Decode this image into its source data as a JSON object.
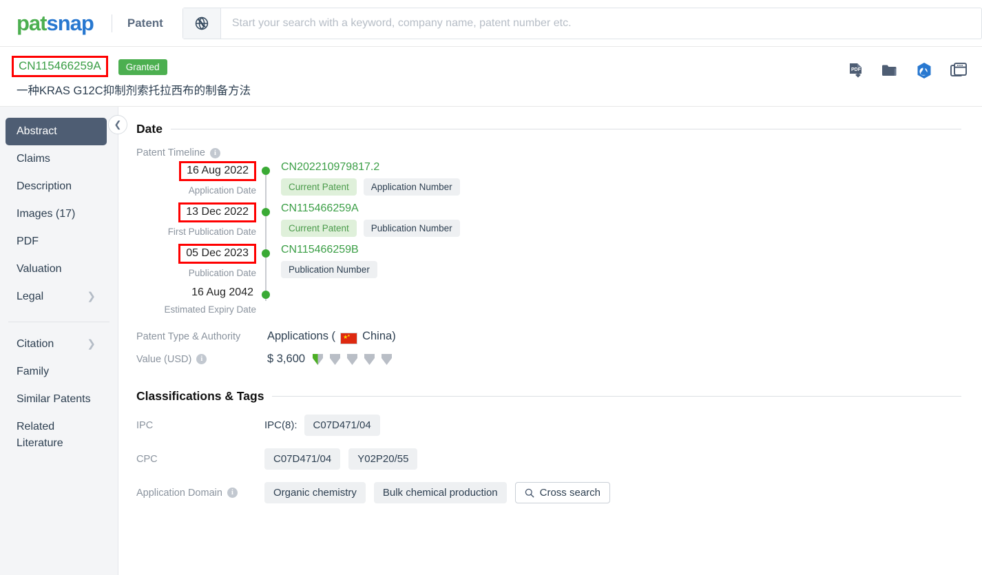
{
  "brand": {
    "logo_pat": "pat",
    "logo_snap": "snap",
    "nav_label": "Patent"
  },
  "search": {
    "placeholder": "Start your search with a keyword, company name, patent number etc.",
    "value": "",
    "globe_icon": "globe-icon"
  },
  "patent": {
    "number": "CN115466259A",
    "status": "Granted",
    "title": "一种KRAS G12C抑制剂索托拉西布的制备方法"
  },
  "toolbar_icons": [
    {
      "name": "pdf-download-icon",
      "label": "PDF"
    },
    {
      "name": "folder-icon",
      "label": "Folder"
    },
    {
      "name": "chemistry-badge-icon",
      "label": "Chemistry"
    },
    {
      "name": "copy-window-icon",
      "label": "Compare"
    }
  ],
  "sidebar": {
    "items": [
      {
        "label": "Abstract",
        "active": true,
        "chevron": false
      },
      {
        "label": "Claims",
        "active": false,
        "chevron": false
      },
      {
        "label": "Description",
        "active": false,
        "chevron": false
      },
      {
        "label": "Images (17)",
        "active": false,
        "chevron": false
      },
      {
        "label": "PDF",
        "active": false,
        "chevron": false
      },
      {
        "label": "Valuation",
        "active": false,
        "chevron": false
      },
      {
        "label": "Legal",
        "active": false,
        "chevron": true
      }
    ],
    "items2": [
      {
        "label": "Citation",
        "active": false,
        "chevron": true
      },
      {
        "label": "Family",
        "active": false,
        "chevron": false
      },
      {
        "label": "Similar Patents",
        "active": false,
        "chevron": false
      }
    ],
    "related_line1": "Related",
    "related_line2": "Literature",
    "collapse_icon": "chevron-left-icon"
  },
  "date_section": {
    "heading": "Date",
    "timeline_label": "Patent Timeline",
    "events": [
      {
        "date": "16 Aug 2022",
        "highlighted": true,
        "sublabel": "Application Date",
        "number": "CN202210979817.2",
        "tags": [
          {
            "text": "Current Patent",
            "style": "green"
          },
          {
            "text": "Application Number",
            "style": "grey"
          }
        ]
      },
      {
        "date": "13 Dec 2022",
        "highlighted": true,
        "sublabel": "First Publication Date",
        "number": "CN115466259A",
        "tags": [
          {
            "text": "Current Patent",
            "style": "green"
          },
          {
            "text": "Publication Number",
            "style": "grey"
          }
        ]
      },
      {
        "date": "05 Dec 2023",
        "highlighted": true,
        "sublabel": "Publication Date",
        "number": "CN115466259B",
        "tags": [
          {
            "text": "Publication Number",
            "style": "grey"
          }
        ]
      },
      {
        "date": "16 Aug 2042",
        "highlighted": false,
        "sublabel": "Estimated Expiry Date",
        "number": "",
        "tags": []
      }
    ],
    "authority_label": "Patent Type & Authority",
    "authority_prefix": "Applications (",
    "authority_country": "China",
    "authority_suffix": ")",
    "value_label": "Value (USD)",
    "value_amount": "$ 3,600",
    "value_rating": 0.5,
    "value_rating_max": 5
  },
  "classification_section": {
    "heading": "Classifications & Tags",
    "ipc_label": "IPC",
    "ipc_prefix": "IPC(8):",
    "ipc_codes": [
      "C07D471/04"
    ],
    "cpc_label": "CPC",
    "cpc_codes": [
      "C07D471/04",
      "Y02P20/55"
    ],
    "domain_label": "Application Domain",
    "domain_tags": [
      "Organic chemistry",
      "Bulk chemical production"
    ],
    "cross_search_label": "Cross search"
  },
  "colors": {
    "brand_green": "#4caf50",
    "brand_blue": "#2878d0",
    "link_green": "#3a9e45",
    "highlight_red": "#ff0000",
    "timeline_dot": "#3aaa35",
    "sidebar_active": "#4e5d73",
    "tag_green_bg": "#dff0da",
    "tag_grey_bg": "#eef0f2",
    "flag_red": "#de2910"
  }
}
